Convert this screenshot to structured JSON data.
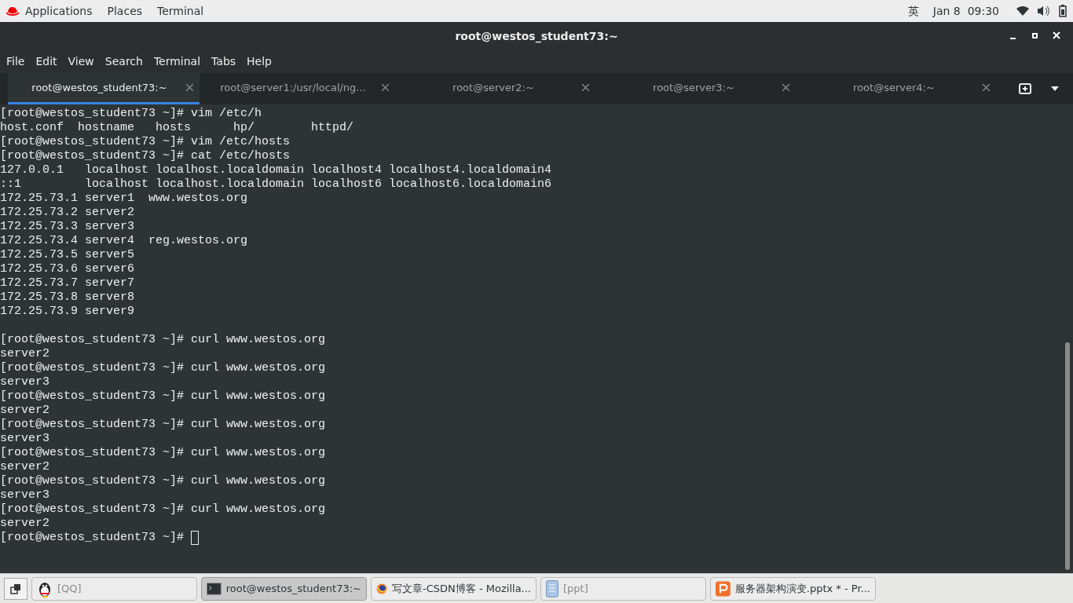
{
  "top_bar": {
    "menus": [
      "Applications",
      "Places",
      "Terminal"
    ],
    "input_method": "英",
    "clock": "Jan 8  09:30"
  },
  "window": {
    "title": "root@westos_student73:~"
  },
  "menu_bar": [
    "File",
    "Edit",
    "View",
    "Search",
    "Terminal",
    "Tabs",
    "Help"
  ],
  "tabs": [
    {
      "label": "root@westos_student73:~",
      "selected": true
    },
    {
      "label": "root@server1:/usr/local/ng...",
      "selected": false
    },
    {
      "label": "root@server2:~",
      "selected": false
    },
    {
      "label": "root@server3:~",
      "selected": false
    },
    {
      "label": "root@server4:~",
      "selected": false
    }
  ],
  "terminal": {
    "paragraphs": [
      [
        "[root@westos_student73 ~]# vim /etc/h",
        "host.conf  hostname   hosts      hp/        httpd/",
        "[root@westos_student73 ~]# vim /etc/hosts",
        "[root@westos_student73 ~]# cat /etc/hosts",
        "127.0.0.1   localhost localhost.localdomain localhost4 localhost4.localdomain4",
        "::1         localhost localhost.localdomain localhost6 localhost6.localdomain6",
        "172.25.73.1 server1  www.westos.org",
        "172.25.73.2 server2",
        "172.25.73.3 server3",
        "172.25.73.4 server4  reg.westos.org",
        "172.25.73.5 server5",
        "172.25.73.6 server6",
        "172.25.73.7 server7",
        "172.25.73.8 server8",
        "172.25.73.9 server9"
      ],
      [
        "[root@westos_student73 ~]# curl www.westos.org",
        "server2",
        "[root@westos_student73 ~]# curl www.westos.org",
        "server3",
        "[root@westos_student73 ~]# curl www.westos.org",
        "server2",
        "[root@westos_student73 ~]# curl www.westos.org",
        "server3",
        "[root@westos_student73 ~]# curl www.westos.org",
        "server2",
        "[root@westos_student73 ~]# curl www.westos.org",
        "server3",
        "[root@westos_student73 ~]# curl www.westos.org",
        "server2"
      ]
    ],
    "prompt": "[root@westos_student73 ~]# "
  },
  "taskbar": [
    {
      "label": "[QQ]",
      "kind": "penguin",
      "selected": false,
      "minimized": true
    },
    {
      "label": "root@westos_student73:~",
      "kind": "terminal",
      "selected": true,
      "minimized": false
    },
    {
      "label": "写文章-CSDN博客 - Mozilla...",
      "kind": "browser",
      "selected": false,
      "minimized": false
    },
    {
      "label": "[ppt]",
      "kind": "document",
      "selected": false,
      "minimized": true
    },
    {
      "label": "服务器架构演变.pptx * - Pr...",
      "kind": "slides",
      "selected": false,
      "minimized": false
    }
  ]
}
